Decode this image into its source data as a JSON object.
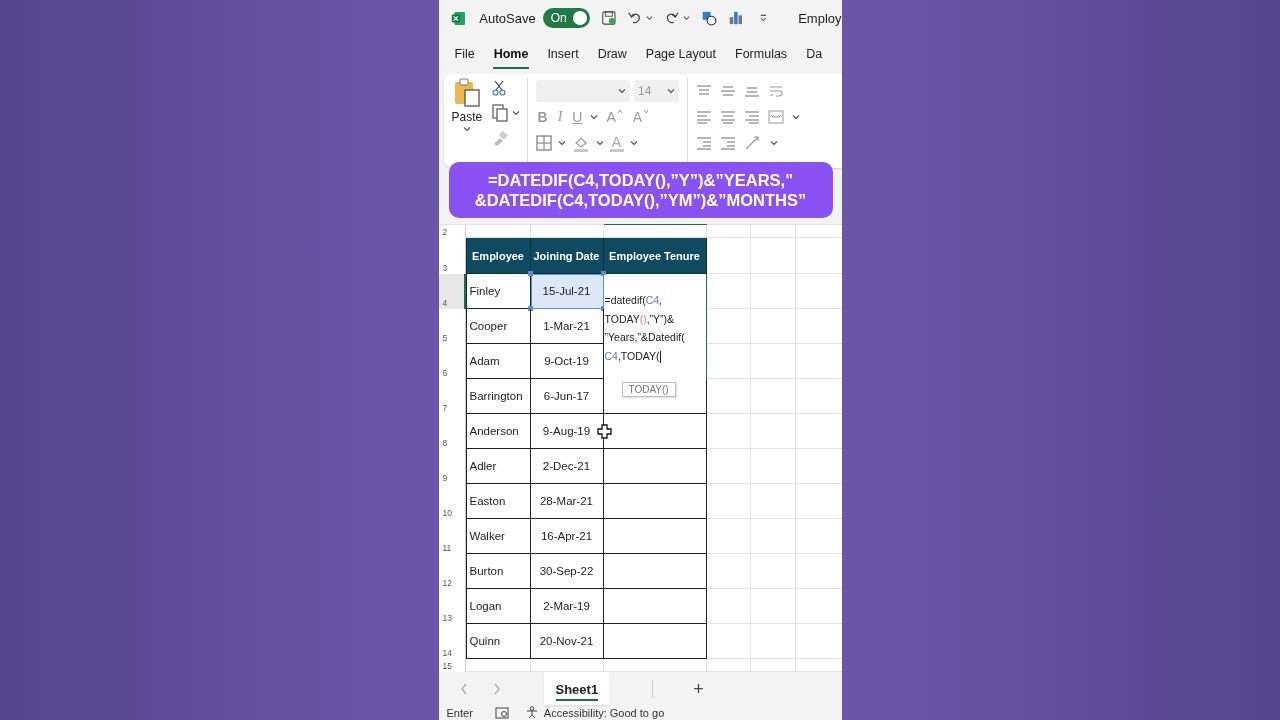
{
  "title_bar": {
    "autosave_label": "AutoSave",
    "autosave": {
      "on": true,
      "label": "On"
    },
    "document_title": "Employ"
  },
  "ribbon_tabs": [
    {
      "label": "File",
      "selected": false
    },
    {
      "label": "Home",
      "selected": true
    },
    {
      "label": "Insert",
      "selected": false
    },
    {
      "label": "Draw",
      "selected": false
    },
    {
      "label": "Page Layout",
      "selected": false
    },
    {
      "label": "Formulas",
      "selected": false
    },
    {
      "label": "Da",
      "selected": false
    }
  ],
  "clipboard": {
    "paste_label": "Paste"
  },
  "font": {
    "size": "14",
    "style_buttons": [
      "B",
      "I",
      "U"
    ],
    "grow_label": "A",
    "shrink_label": "A",
    "color_label": "A"
  },
  "caption": {
    "lines": [
      "=DATEDIF(C4,TODAY(),”Y”)&”YEARS,\"",
      "&DATEDIF(C4,TODAY(),”YM”)&”MONTHS”"
    ]
  },
  "sheet": {
    "row_numbers": [
      "2",
      "3",
      "4",
      "5",
      "6",
      "7",
      "8",
      "9",
      "10",
      "11",
      "12",
      "13",
      "14",
      "15"
    ],
    "headers": [
      "Employee",
      "Joining Date",
      "Employee Tenure"
    ],
    "rows": [
      {
        "name": "Finley",
        "date": "15-Jul-21",
        "selected": true
      },
      {
        "name": "Cooper",
        "date": "1-Mar-21",
        "selected": false
      },
      {
        "name": "Adam",
        "date": "9-Oct-19",
        "selected": false
      },
      {
        "name": "Barrington",
        "date": "6-Jun-17",
        "selected": false
      },
      {
        "name": "Anderson",
        "date": "9-Aug-19",
        "selected": false
      },
      {
        "name": "Adler",
        "date": "2-Dec-21",
        "selected": false
      },
      {
        "name": "Easton",
        "date": "28-Mar-21",
        "selected": false
      },
      {
        "name": "Walker",
        "date": "16-Apr-21",
        "selected": false
      },
      {
        "name": "Burton",
        "date": "30-Sep-22",
        "selected": false
      },
      {
        "name": "Logan",
        "date": "2-Mar-19",
        "selected": false
      },
      {
        "name": "Quinn",
        "date": "20-Nov-21",
        "selected": false
      }
    ],
    "editor": {
      "lines": [
        [
          {
            "text": "=datedif(",
            "kind": "plain"
          },
          {
            "text": "C4",
            "kind": "ref"
          },
          {
            "text": ",",
            "kind": "plain"
          }
        ],
        [
          {
            "text": "TODAY",
            "kind": "plain"
          },
          {
            "text": "()",
            "kind": "paren"
          },
          {
            "text": ",”Y”)&",
            "kind": "plain"
          }
        ],
        [
          {
            "text": "”Years,”&Datedif(",
            "kind": "plain"
          }
        ],
        [
          {
            "text": "C4",
            "kind": "ref"
          },
          {
            "text": ",TODAY(",
            "kind": "plain"
          }
        ]
      ]
    },
    "tooltip": "TODAY()"
  },
  "footer": {
    "sheet_tabs": [
      {
        "label": "Sheet1",
        "selected": true
      }
    ],
    "add_label": "+"
  },
  "status_bar": {
    "mode": "Enter",
    "accessibility": "Accessibility: Good to go"
  }
}
